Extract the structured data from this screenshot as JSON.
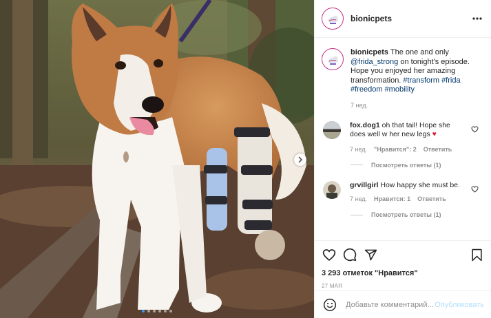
{
  "post": {
    "username": "bionicpets",
    "caption": {
      "username": "bionicpets",
      "text_1": " The one and only ",
      "mention": "@frida_strong",
      "text_2": " on tonight's episode. Hope you enjoyed her amazing transformation. ",
      "tag_1": "#transform",
      "tag_2": "#frida",
      "tag_3": "#freedom",
      "tag_4": "#mobility",
      "time": "7 нед."
    },
    "comments": [
      {
        "username": "fox.dog1",
        "text": " oh that tail! Hope she does well w her new legs ",
        "emoji": "♥",
        "time": "7 нед.",
        "likes": "\"Нравится\": 2",
        "reply": "Ответить",
        "view_replies": "Посмотреть ответы (1)"
      },
      {
        "username": "grvillgirl",
        "text": " How happy she must be.",
        "time": "7 нед.",
        "likes": "Нравится: 1",
        "reply": "Ответить",
        "view_replies": "Посмотреть ответы (1)"
      }
    ],
    "likes_count": "3 293 отметок \"Нравится\"",
    "date": "27 МАЯ",
    "comment_placeholder": "Добавьте комментарий...",
    "publish_label": "Опубликовать"
  },
  "carousel": {
    "total": 6,
    "active": 0
  },
  "colors": {
    "accent_link": "#00376b",
    "publish_disabled": "#b2dffc",
    "active_dot": "#3897f0"
  },
  "icons": [
    "more-icon",
    "heart-icon",
    "comment-icon",
    "share-icon",
    "bookmark-icon",
    "emoji-icon",
    "chevron-right-icon"
  ]
}
